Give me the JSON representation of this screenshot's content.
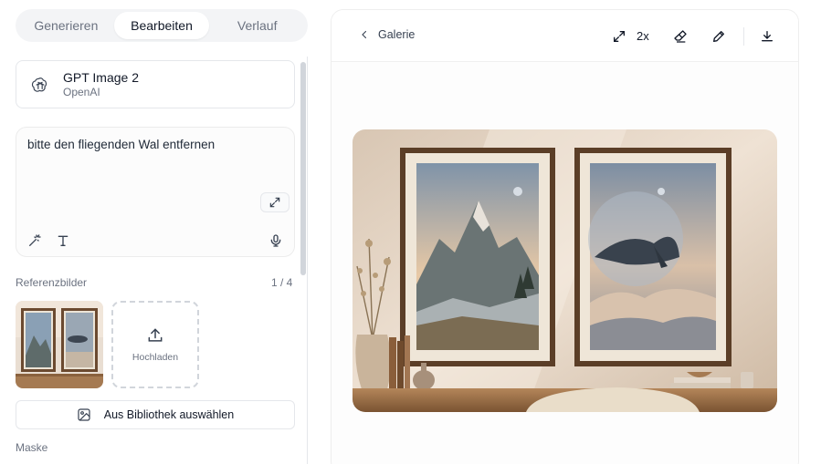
{
  "tabs": [
    {
      "label": "Generieren",
      "active": false
    },
    {
      "label": "Bearbeiten",
      "active": true
    },
    {
      "label": "Verlauf",
      "active": false
    }
  ],
  "model": {
    "name": "GPT Image 2",
    "vendor": "OpenAI",
    "icon": "openai-logo-icon"
  },
  "prompt": {
    "value": "bitte den fliegenden Wal entfernen"
  },
  "references": {
    "label": "Referenzbilder",
    "count": "1 / 4",
    "upload_label": "Hochladen"
  },
  "library_button": {
    "label": "Aus Bibliothek auswählen"
  },
  "mask": {
    "label": "Maske"
  },
  "viewer": {
    "back_label": "Galerie",
    "zoom_label": "2x"
  },
  "colors": {
    "accent_bg": "#f3f4f6",
    "border": "#e5e7eb",
    "muted_text": "#6b7280"
  }
}
